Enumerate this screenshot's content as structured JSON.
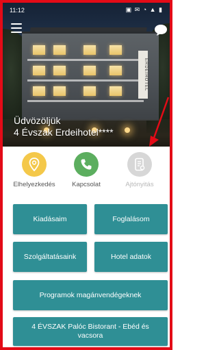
{
  "status_bar": {
    "time": "11:12",
    "icons": "▣ ✉ ◔ ▲ ▮",
    "text_color": "#ffffff"
  },
  "app_bar": {
    "menu_icon": "hamburger-menu-icon",
    "chat_icon": "chat-bubble-icon"
  },
  "hero": {
    "welcome_line1": "Üdvözöljük",
    "hotel_name": "4 Évszak Erdeihotel****",
    "building_sign": "ERDEIHOTEL"
  },
  "quick_actions": [
    {
      "label": "Elhelyezkedés",
      "icon": "location-pin-icon",
      "color": "#f4c84a",
      "enabled": true
    },
    {
      "label": "Kapcsolat",
      "icon": "phone-icon",
      "color": "#5cae5f",
      "enabled": true
    },
    {
      "label": "Ajtónyitás",
      "icon": "door-key-icon",
      "color": "#d7d7d7",
      "enabled": false
    }
  ],
  "menu_buttons": {
    "kiadasaim": "Kiadásaim",
    "foglalasom": "Foglalásom",
    "szolgaltatasaink": "Szolgáltatásaink",
    "hotel_adatok": "Hotel adatok",
    "programok": "Programok magánvendégeknek",
    "bistorant": "4 ÉVSZAK Palóc Bistorant - Ebéd és vacsora"
  },
  "colors": {
    "accent_teal": "#2f8f95",
    "annotation_red": "#e30b17",
    "background": "#ffffff"
  }
}
